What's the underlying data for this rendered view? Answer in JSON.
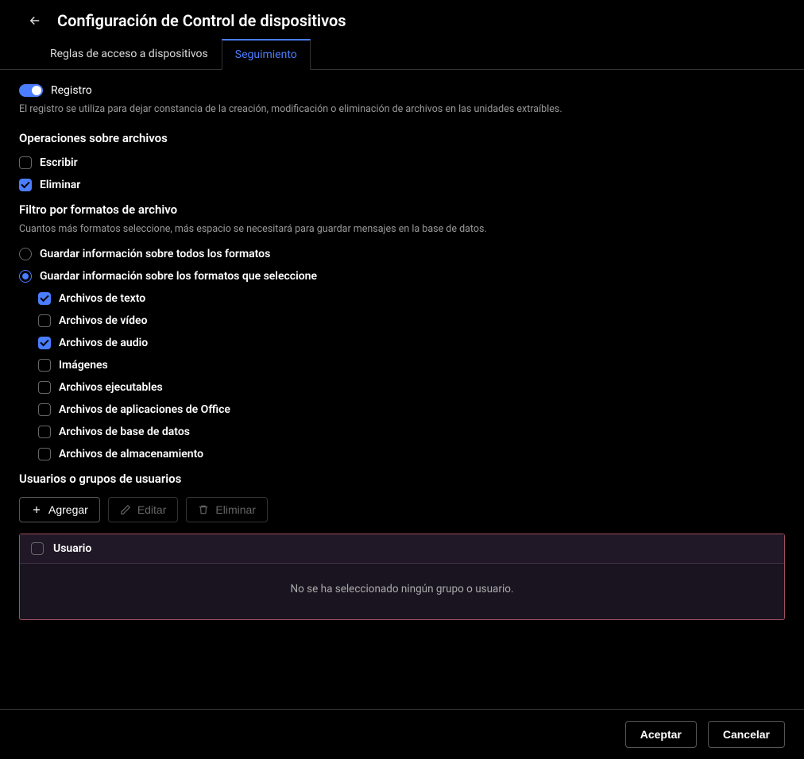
{
  "header": {
    "title": "Configuración de Control de dispositivos"
  },
  "tabs": [
    {
      "label": "Reglas de acceso a dispositivos",
      "active": false
    },
    {
      "label": "Seguimiento",
      "active": true
    }
  ],
  "registro": {
    "label": "Registro",
    "desc": "El registro se utiliza para dejar constancia de la creación, modificación o eliminación de archivos en las unidades extraíbles.",
    "enabled": true
  },
  "operations": {
    "title": "Operaciones sobre archivos",
    "items": [
      {
        "label": "Escribir",
        "checked": false
      },
      {
        "label": "Eliminar",
        "checked": true
      }
    ]
  },
  "filter": {
    "title": "Filtro por formatos de archivo",
    "hint": "Cuantos más formatos seleccione, más espacio se necesitará para guardar mensajes en la base de datos.",
    "radios": [
      {
        "label": "Guardar información sobre todos los formatos",
        "selected": false
      },
      {
        "label": "Guardar información sobre los formatos que seleccione",
        "selected": true
      }
    ],
    "formats": [
      {
        "label": "Archivos de texto",
        "checked": true
      },
      {
        "label": "Archivos de vídeo",
        "checked": false
      },
      {
        "label": "Archivos de audio",
        "checked": true
      },
      {
        "label": "Imágenes",
        "checked": false
      },
      {
        "label": "Archivos ejecutables",
        "checked": false
      },
      {
        "label": "Archivos de aplicaciones de Office",
        "checked": false
      },
      {
        "label": "Archivos de base de datos",
        "checked": false
      },
      {
        "label": "Archivos de almacenamiento",
        "checked": false
      }
    ]
  },
  "users": {
    "title": "Usuarios o grupos de usuarios",
    "add": "Agregar",
    "edit": "Editar",
    "delete": "Eliminar",
    "column": "Usuario",
    "empty": "No se ha seleccionado ningún grupo o usuario."
  },
  "footer": {
    "accept": "Aceptar",
    "cancel": "Cancelar"
  }
}
